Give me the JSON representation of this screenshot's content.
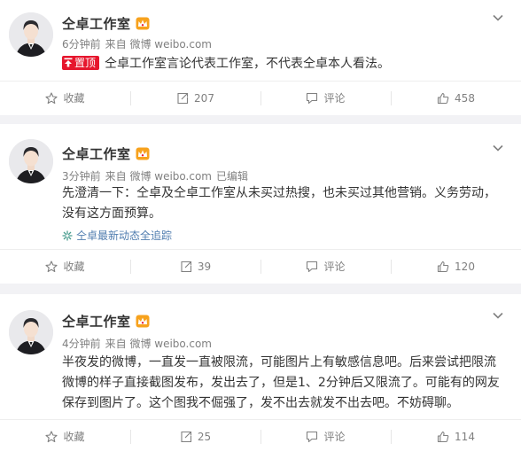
{
  "colors": {
    "page_bg": "#f2f2f5",
    "card_bg": "#ffffff",
    "text": "#333333",
    "meta_text": "#808080",
    "link": "#507daf",
    "pin_red": "#e6162d",
    "vip_badge": "#f7a21d"
  },
  "posts": [
    {
      "author": "仝卓工作室",
      "author_badge": "vip-crown-icon",
      "time": "6分钟前",
      "source": "来自 微博 weibo.com",
      "edited": "",
      "pin_label": "置顶",
      "text": "仝卓工作室言论代表工作室，不代表仝卓本人看法。",
      "topic": "",
      "actions": {
        "favorite": "收藏",
        "repost": "207",
        "comment": "评论",
        "like": "458"
      }
    },
    {
      "author": "仝卓工作室",
      "author_badge": "vip-crown-icon",
      "time": "3分钟前",
      "source": "来自 微博 weibo.com",
      "edited": "已编辑",
      "pin_label": "",
      "text": "先澄清一下：仝卓及仝卓工作室从未买过热搜，也未买过其他营销。义务劳动，没有这方面预算。",
      "topic": "仝卓最新动态全追踪",
      "actions": {
        "favorite": "收藏",
        "repost": "39",
        "comment": "评论",
        "like": "120"
      }
    },
    {
      "author": "仝卓工作室",
      "author_badge": "vip-crown-icon",
      "time": "4分钟前",
      "source": "来自 微博 weibo.com",
      "edited": "",
      "pin_label": "",
      "text": "半夜发的微博，一直发一直被限流，可能图片上有敏感信息吧。后来尝试把限流微博的样子直接截图发布，发出去了，但是1、2分钟后又限流了。可能有的网友保存到图片了。这个图我不倔强了，发不出去就发不出去吧。不妨碍聊。",
      "topic": "",
      "actions": {
        "favorite": "收藏",
        "repost": "25",
        "comment": "评论",
        "like": "114"
      }
    }
  ]
}
